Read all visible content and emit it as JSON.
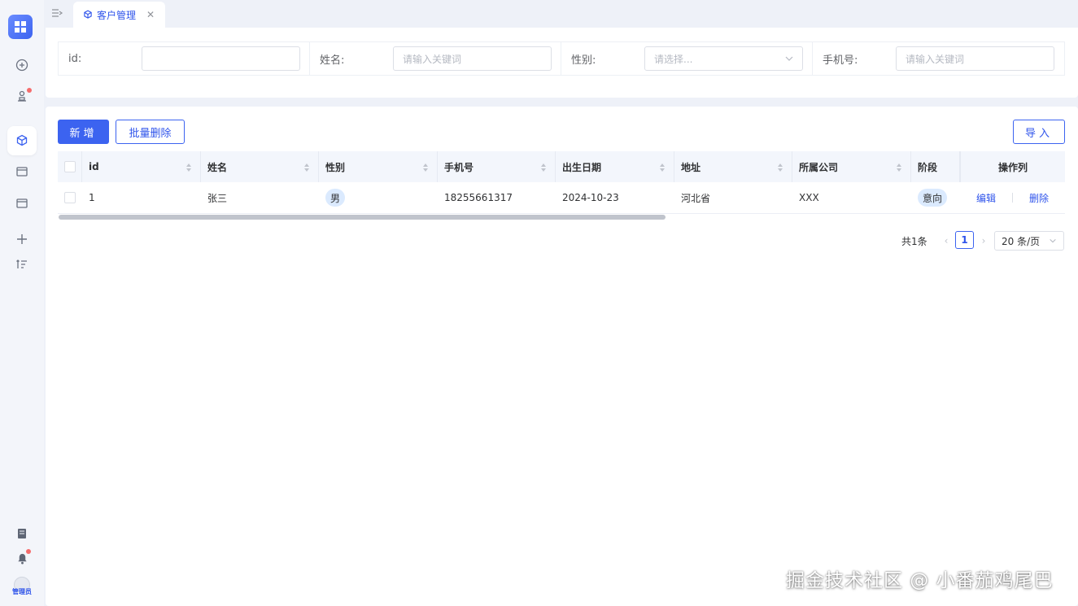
{
  "tabs": [
    {
      "label": "客户管理",
      "icon": "cube-icon"
    }
  ],
  "search": {
    "fields": [
      {
        "label": "id:",
        "value": "",
        "placeholder": ""
      },
      {
        "label": "姓名:",
        "value": "",
        "placeholder": "请输入关键词"
      },
      {
        "label": "性别:",
        "value": "",
        "placeholder": "请选择..."
      },
      {
        "label": "手机号:",
        "value": "",
        "placeholder": "请输入关键词"
      }
    ]
  },
  "toolbar": {
    "add_label": "新增",
    "batch_delete_label": "批量删除",
    "import_label": "导入"
  },
  "table": {
    "columns": [
      "id",
      "姓名",
      "性别",
      "手机号",
      "出生日期",
      "地址",
      "所属公司",
      "阶段",
      "操作列"
    ],
    "rows": [
      {
        "id": "1",
        "name": "张三",
        "gender": "男",
        "phone": "18255661317",
        "birth": "2024-10-23",
        "address": "河北省",
        "company": "XXX",
        "stage": "意向",
        "edit": "编辑",
        "delete": "删除"
      }
    ]
  },
  "pagination": {
    "total": "共1条",
    "current": "1",
    "page_size": "20 条/页"
  },
  "user": {
    "label": "管理员"
  },
  "watermark": "掘金技术社区 @ 小番茄鸡尾巴",
  "colors": {
    "primary": "#3c63f0",
    "tag_bg": "#dbeafe",
    "badge": "#f56c6c"
  }
}
